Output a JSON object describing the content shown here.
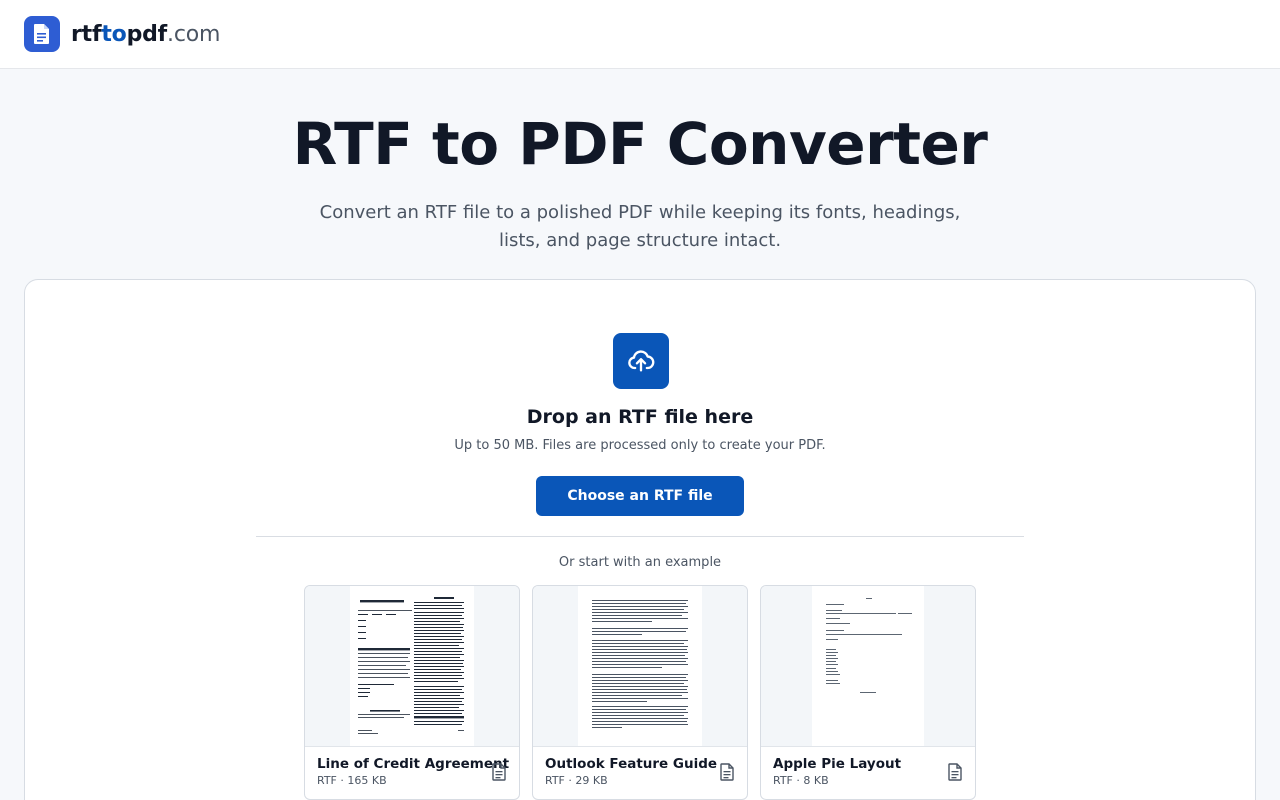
{
  "header": {
    "logo": {
      "part1": "rtf",
      "part2": "to",
      "part3": "pdf",
      "tld": ".com",
      "icon": "document-icon"
    }
  },
  "hero": {
    "title": "RTF to PDF Converter",
    "subtitle": "Convert an RTF file to a polished PDF while keeping its fonts, headings, lists, and page structure intact."
  },
  "upload": {
    "icon": "cloud-upload-icon",
    "title": "Drop an RTF file here",
    "note": "Up to 50 MB. Files are processed only to create your PDF.",
    "button_label": "Choose an RTF file"
  },
  "examples": {
    "label": "Or start with an example",
    "items": [
      {
        "title": "Line of Credit Agreement",
        "meta": "RTF · 165 KB",
        "icon": "file-text-icon"
      },
      {
        "title": "Outlook Feature Guide",
        "meta": "RTF · 29 KB",
        "icon": "file-text-icon"
      },
      {
        "title": "Apple Pie Layout",
        "meta": "RTF · 8 KB",
        "icon": "file-text-icon"
      }
    ]
  },
  "colors": {
    "brand": "#0a56b8",
    "logo_bg": "#2e5dd3",
    "page_bg": "#f6f8fb",
    "text": "#111827",
    "muted": "#4b5563"
  }
}
